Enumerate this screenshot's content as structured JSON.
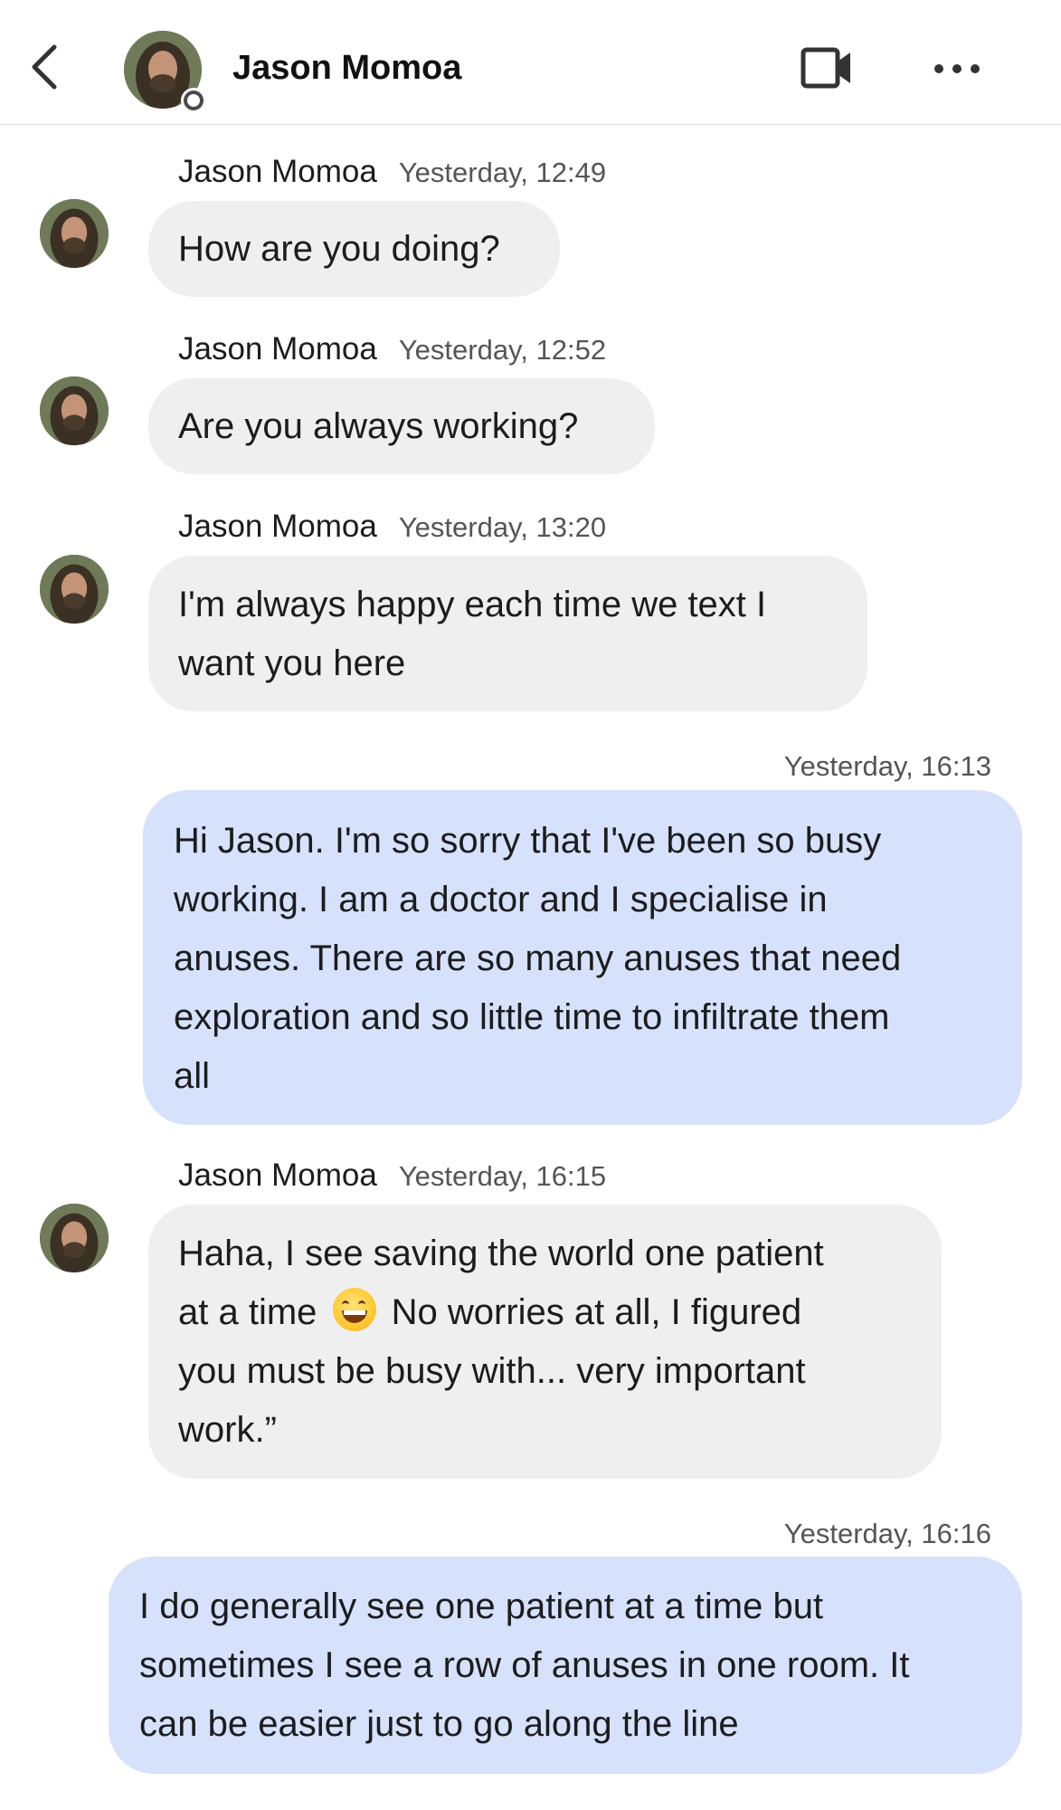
{
  "header": {
    "contact_name": "Jason Momoa",
    "back_icon": "chevron-left-icon",
    "video_icon": "video-camera-icon",
    "more_icon": "more-horizontal-icon"
  },
  "messages": [
    {
      "direction": "incoming",
      "sender": "Jason Momoa",
      "time": "Yesterday, 12:49",
      "text": "How are you doing?"
    },
    {
      "direction": "incoming",
      "sender": "Jason Momoa",
      "time": "Yesterday, 12:52",
      "text": "Are you  always working?"
    },
    {
      "direction": "incoming",
      "sender": "Jason Momoa",
      "time": "Yesterday, 13:20",
      "text": "I'm always happy each time we text I\nwant you here"
    },
    {
      "direction": "outgoing",
      "time": "Yesterday, 16:13",
      "text": "Hi Jason. I'm so sorry that I've been so busy\nworking. I am a doctor and I specialise in\nanuses. There are so many anuses that need\nexploration and so little time to infiltrate them\nall"
    },
    {
      "direction": "incoming",
      "sender": "Jason Momoa",
      "time": "Yesterday, 16:15",
      "text_part1": "Haha, I see  saving the world one patient\nat a time ",
      "emoji": "grinning-face-emoji",
      "text_part2": " No worries at all, I figured\nyou must be busy with... very important\nwork.”"
    },
    {
      "direction": "outgoing",
      "time": "Yesterday, 16:16",
      "text": "I do generally see one patient at a time but\nsometimes I see a row of anuses in one room. It\ncan be easier just to go along the line"
    }
  ],
  "colors": {
    "incoming_bubble": "#efefef",
    "outgoing_bubble": "#d6e2fb",
    "header_divider": "#dcdcdc"
  }
}
